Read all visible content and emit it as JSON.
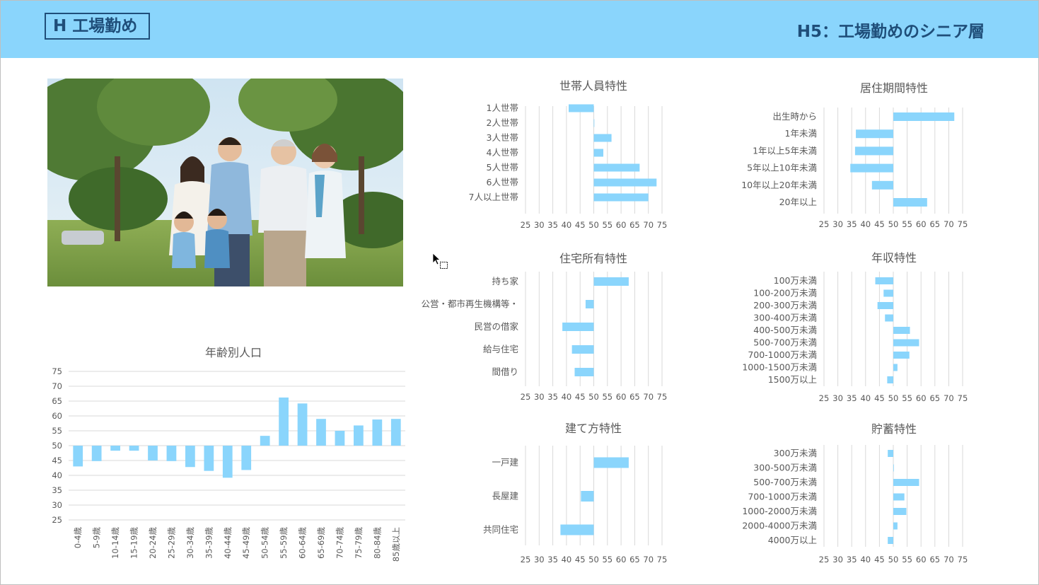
{
  "header": {
    "section_label": "H 工場勤め",
    "page_title": "H5：工場勤めのシニア層"
  },
  "photo": {
    "description_icon": "family-photo"
  },
  "colors": {
    "header_bg": "#8ad5fc",
    "title_color": "#1f4e79",
    "bar": "#8ad5fc",
    "grid": "#d9d9d9"
  },
  "chart_data": [
    {
      "id": "age",
      "type": "bar",
      "title": "年齢別人口",
      "baseline": 50,
      "ylim": [
        25,
        75
      ],
      "yticks": [
        75,
        70,
        65,
        60,
        55,
        50,
        45,
        40,
        35,
        30,
        25
      ],
      "categories": [
        "0-4歳",
        "5-9歳",
        "10-14歳",
        "15-19歳",
        "20-24歳",
        "25-29歳",
        "30-34歳",
        "35-39歳",
        "40-44歳",
        "45-49歳",
        "50-54歳",
        "55-59歳",
        "60-64歳",
        "65-69歳",
        "70-74歳",
        "75-79歳",
        "80-84歳",
        "85歳以上"
      ],
      "values": [
        43,
        44.8,
        48.3,
        48.3,
        45,
        44.8,
        42.8,
        41.5,
        39.2,
        41.8,
        53.3,
        66.2,
        64.2,
        59,
        55,
        56.8,
        58.8,
        59
      ]
    },
    {
      "id": "household",
      "type": "barh",
      "title": "世帯人員特性",
      "baseline": 50,
      "xlim": [
        25,
        75
      ],
      "xticks": [
        25,
        30,
        35,
        40,
        45,
        50,
        55,
        60,
        65,
        70,
        75
      ],
      "categories": [
        "1人世帯",
        "2人世帯",
        "3人世帯",
        "4人世帯",
        "5人世帯",
        "6人世帯",
        "7人以上世帯"
      ],
      "values": [
        40.8,
        50,
        56.5,
        53.5,
        66.8,
        73,
        70
      ]
    },
    {
      "id": "residence",
      "type": "barh",
      "title": "居住期間特性",
      "baseline": 50,
      "xlim": [
        25,
        75
      ],
      "xticks": [
        25,
        30,
        35,
        40,
        45,
        50,
        55,
        60,
        65,
        70,
        75
      ],
      "categories": [
        "出生時から",
        "1年未満",
        "1年以上5年未満",
        "5年以上10年未満",
        "10年以上20年未満",
        "20年以上"
      ],
      "values": [
        72,
        36.5,
        36.2,
        34.5,
        42.3,
        62.2
      ]
    },
    {
      "id": "housing",
      "type": "barh",
      "title": "住宅所有特性",
      "baseline": 50,
      "xlim": [
        25,
        75
      ],
      "xticks": [
        25,
        30,
        35,
        40,
        45,
        50,
        55,
        60,
        65,
        70,
        75
      ],
      "categories": [
        "持ち家",
        "公営・都市再生機構等・",
        "民営の借家",
        "給与住宅",
        "間借り"
      ],
      "values": [
        62.8,
        47,
        38.5,
        42,
        43
      ]
    },
    {
      "id": "income",
      "type": "barh",
      "title": "年収特性",
      "baseline": 50,
      "xlim": [
        25,
        75
      ],
      "xticks": [
        25,
        30,
        35,
        40,
        45,
        50,
        55,
        60,
        65,
        70,
        75
      ],
      "categories": [
        "100万未満",
        "100-200万未満",
        "200-300万未満",
        "300-400万未満",
        "400-500万未満",
        "500-700万未満",
        "700-1000万未満",
        "1000-1500万未満",
        "1500万以上"
      ],
      "values": [
        43.5,
        46.5,
        44.3,
        47,
        56,
        59.3,
        55.8,
        51.5,
        47.8
      ]
    },
    {
      "id": "building",
      "type": "barh",
      "title": "建て方特性",
      "baseline": 50,
      "xlim": [
        25,
        75
      ],
      "xticks": [
        25,
        30,
        35,
        40,
        45,
        50,
        55,
        60,
        65,
        70,
        75
      ],
      "categories": [
        "一戸建",
        "長屋建",
        "共同住宅"
      ],
      "values": [
        62.8,
        45.3,
        37.8
      ]
    },
    {
      "id": "savings",
      "type": "barh",
      "title": "貯蓄特性",
      "baseline": 50,
      "xlim": [
        25,
        75
      ],
      "xticks": [
        25,
        30,
        35,
        40,
        45,
        50,
        55,
        60,
        65,
        70,
        75
      ],
      "categories": [
        "300万未満",
        "300-500万未満",
        "500-700万未満",
        "700-1000万未満",
        "1000-2000万未満",
        "2000-4000万未満",
        "4000万以上"
      ],
      "values": [
        48,
        50.2,
        59.3,
        54,
        54.7,
        51.5,
        48
      ]
    }
  ]
}
